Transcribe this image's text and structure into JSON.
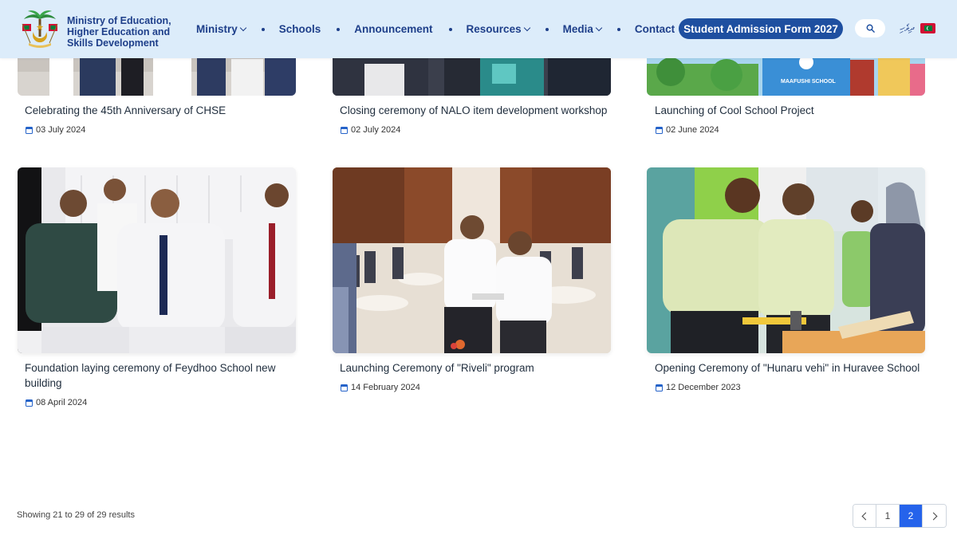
{
  "header": {
    "brand_line1": "Ministry of Education,",
    "brand_line2": "Higher Education and",
    "brand_line3": "Skills Development",
    "nav": [
      {
        "label": "Ministry",
        "has_dropdown": true
      },
      {
        "label": "Schools",
        "has_dropdown": false
      },
      {
        "label": "Announcement",
        "has_dropdown": false
      },
      {
        "label": "Resources",
        "has_dropdown": true
      },
      {
        "label": "Media",
        "has_dropdown": true
      },
      {
        "label": "Contact",
        "has_dropdown": false
      }
    ],
    "cta_label": "Student Admission Form 2027",
    "language_label": "ދިވެހި",
    "search_icon": "search-icon",
    "flag_icon": "maldives-flag-icon"
  },
  "posts_top": [
    {
      "title": "Celebrating the 45th Anniversary of CHSE",
      "date": "03 July 2024"
    },
    {
      "title": "Closing ceremony of NALO item development workshop",
      "date": "02 July 2024"
    },
    {
      "title": "Launching of Cool School Project",
      "date": "02 June 2024"
    }
  ],
  "posts_bottom": [
    {
      "title": "Foundation laying ceremony of Feydhoo School new building",
      "date": "08 April 2024"
    },
    {
      "title": "Launching Ceremony of \"Riveli\" program",
      "date": "14 February 2024"
    },
    {
      "title": "Opening Ceremony of \"Hunaru vehi\" in Huravee School",
      "date": "12 December 2023"
    }
  ],
  "image_texts": {
    "school_banner": "MAAFUSHI SCHOOL"
  },
  "pagination": {
    "summary": "Showing 21 to 29 of 29 results",
    "pages": [
      "1",
      "2"
    ],
    "current_page": "2"
  },
  "colors": {
    "header_bg": "#dcecfa",
    "brand_blue": "#1e3f8a",
    "cta_bg": "#1e4fa0",
    "active_page": "#2563eb"
  }
}
